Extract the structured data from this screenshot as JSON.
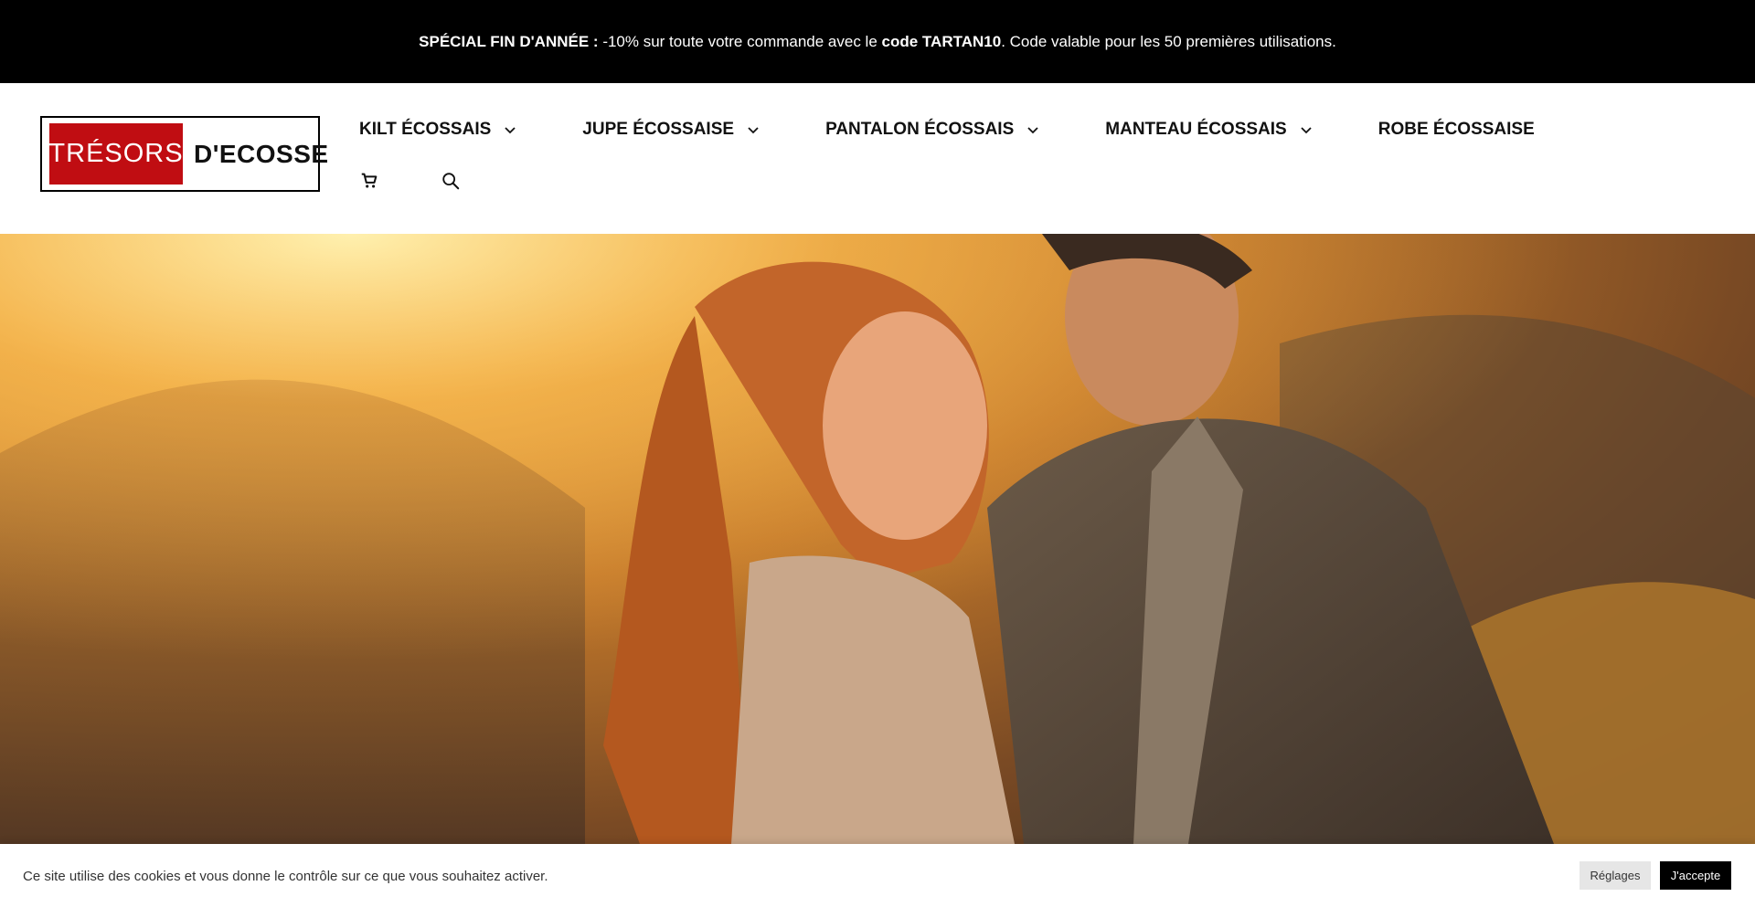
{
  "promo": {
    "prefix_bold": "SPÉCIAL FIN D'ANNÉE",
    "glyph": " ",
    "colon": " : ",
    "middle": "-10% sur toute votre commande avec le ",
    "code_bold": "code TARTAN10",
    "suffix": ". Code valable pour les 50 premières utilisations."
  },
  "logo": {
    "part1": "TRÉSORS",
    "part2": "D'ECOSSE",
    "accent_color": "#c00d12"
  },
  "nav": {
    "items": [
      {
        "label": "KILT ÉCOSSAIS",
        "has_dropdown": true
      },
      {
        "label": "JUPE ÉCOSSAISE",
        "has_dropdown": true
      },
      {
        "label": "PANTALON ÉCOSSAIS",
        "has_dropdown": true
      },
      {
        "label": "MANTEAU ÉCOSSAIS",
        "has_dropdown": true
      },
      {
        "label": "ROBE ÉCOSSAISE",
        "has_dropdown": false
      }
    ],
    "icons": [
      "cart-icon",
      "search-icon"
    ]
  },
  "hero": {
    "image": "couple-in-highlands-sunset"
  },
  "cookie": {
    "text": "Ce site utilise des cookies et vous donne le contrôle sur ce que vous souhaitez activer.",
    "settings_label": "Réglages",
    "accept_label": "J'accepte"
  }
}
